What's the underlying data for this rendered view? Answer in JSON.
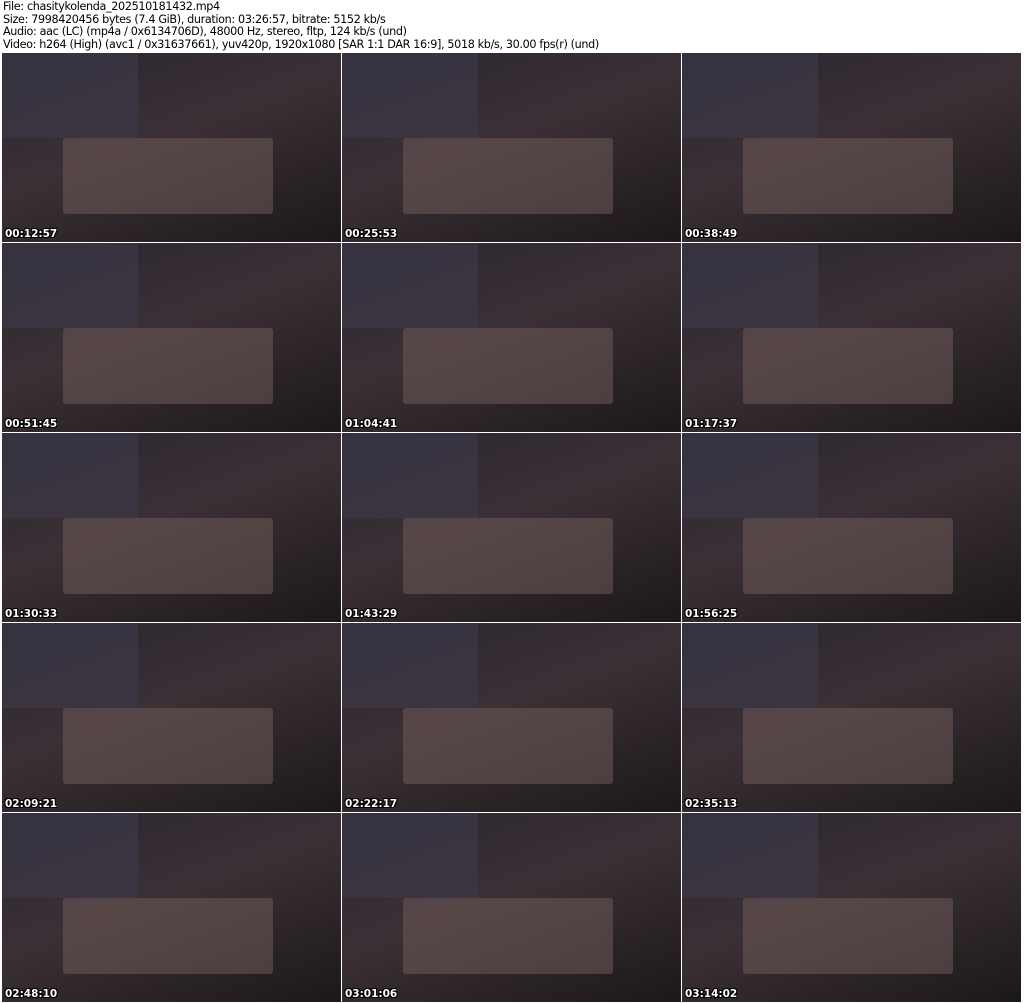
{
  "header": {
    "file": "File: chasitykolenda_202510181432.mp4",
    "size": "Size: 7998420456 bytes (7.4 GiB), duration: 03:26:57, bitrate: 5152 kb/s",
    "audio": "Audio: aac (LC) (mp4a / 0x6134706D), 48000 Hz, stereo, fltp, 124 kb/s (und)",
    "video": "Video: h264 (High) (avc1 / 0x31637661), yuv420p, 1920x1080 [SAR 1:1 DAR 16:9], 5018 kb/s, 30.00 fps(r) (und)"
  },
  "thumbnails": [
    {
      "time": "00:12:57"
    },
    {
      "time": "00:25:53"
    },
    {
      "time": "00:38:49"
    },
    {
      "time": "00:51:45"
    },
    {
      "time": "01:04:41"
    },
    {
      "time": "01:17:37"
    },
    {
      "time": "01:30:33"
    },
    {
      "time": "01:43:29"
    },
    {
      "time": "01:56:25"
    },
    {
      "time": "02:09:21"
    },
    {
      "time": "02:22:17"
    },
    {
      "time": "02:35:13"
    },
    {
      "time": "02:48:10"
    },
    {
      "time": "03:01:06"
    },
    {
      "time": "03:14:02"
    }
  ]
}
